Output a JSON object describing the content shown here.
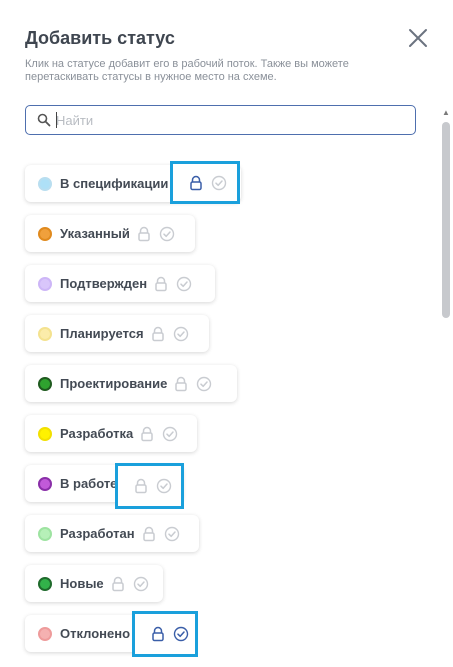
{
  "header": {
    "title": "Добавить статус",
    "description": "Клик на статусе добавит его в рабочий поток. Также вы можете перетаскивать статусы в нужное место на схеме.",
    "close_icon": "close-icon"
  },
  "search": {
    "placeholder": "Найти",
    "value": ""
  },
  "colors": {
    "accent": "#1aa0dc",
    "search_border": "#4e6fae",
    "lock_active": "#3a5ea8",
    "check_active": "#3a5ea8",
    "icon_inactive": "#c9ccd1"
  },
  "statuses": [
    {
      "label": "В спецификации",
      "color": "#aee0f7",
      "ring": "#b9def0",
      "lock_active": true,
      "check_active": false
    },
    {
      "label": "Указанный",
      "color": "#f0a03c",
      "ring": "#e08a1e",
      "lock_active": false,
      "check_active": false
    },
    {
      "label": "Подтвержден",
      "color": "#d9c6fb",
      "ring": "#cdb6f7",
      "lock_active": false,
      "check_active": false
    },
    {
      "label": "Планируется",
      "color": "#fbecaa",
      "ring": "#f4e28f",
      "lock_active": false,
      "check_active": false
    },
    {
      "label": "Проектирование",
      "color": "#2fa32f",
      "ring": "#1f5a1f",
      "lock_active": false,
      "check_active": false
    },
    {
      "label": "Разработка",
      "color": "#fff200",
      "ring": "#f2e000",
      "lock_active": false,
      "check_active": false
    },
    {
      "label": "В работе",
      "color": "#c15ad9",
      "ring": "#8a2fa8",
      "lock_active": false,
      "check_active": false
    },
    {
      "label": "Разработан",
      "color": "#b6f0b8",
      "ring": "#9ee3a1",
      "lock_active": false,
      "check_active": false
    },
    {
      "label": "Новые",
      "color": "#32b24a",
      "ring": "#1f6a2c",
      "lock_active": false,
      "check_active": false
    },
    {
      "label": "Отклонено",
      "color": "#f5b1b1",
      "ring": "#ee9b9b",
      "lock_active": true,
      "check_active": true
    }
  ]
}
